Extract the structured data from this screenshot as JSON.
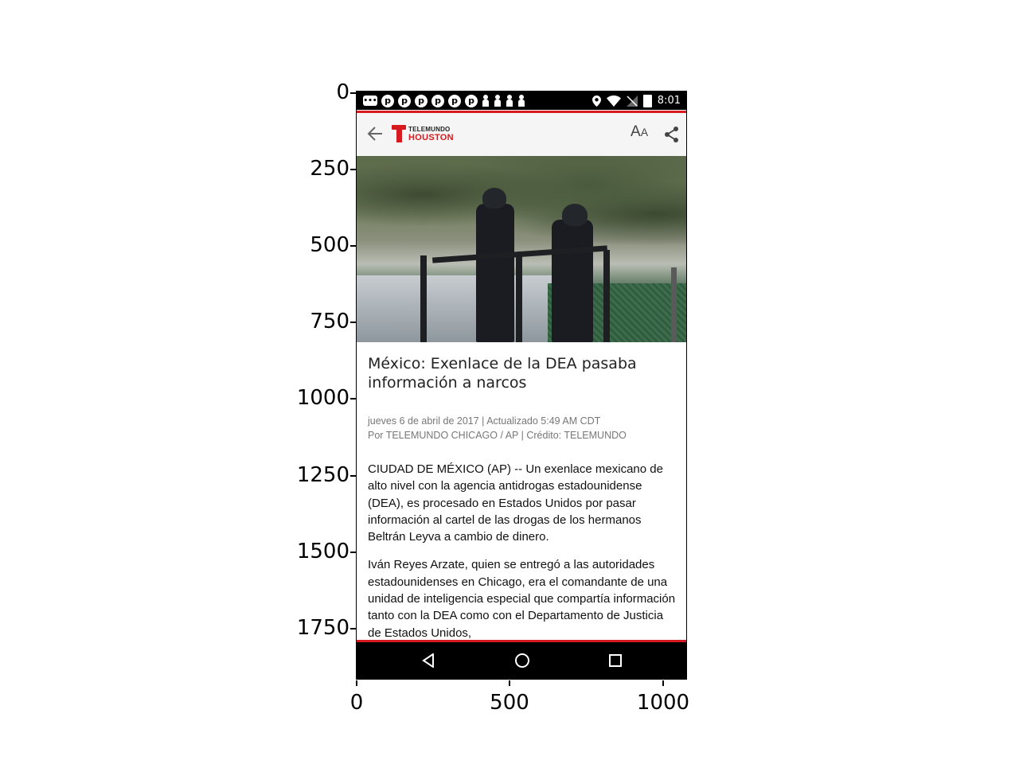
{
  "axes": {
    "y_ticks": [
      "0",
      "250",
      "500",
      "750",
      "1000",
      "1250",
      "1500",
      "1750"
    ],
    "x_ticks": [
      "0",
      "500",
      "1000"
    ]
  },
  "status_bar": {
    "time": "8:01",
    "notification_icons": [
      "message-icon",
      "pinterest-icon",
      "pinterest-icon",
      "pinterest-icon",
      "pinterest-icon",
      "pinterest-icon",
      "pinterest-icon",
      "pawn-icon",
      "pawn-icon",
      "pawn-icon",
      "pawn-icon"
    ],
    "system_icons": [
      "location-icon",
      "wifi-icon",
      "signal-icon",
      "battery-icon"
    ]
  },
  "app_bar": {
    "logo_top": "TELEMUNDO",
    "logo_bottom": "HOUSTON",
    "font_size_label_big": "A",
    "font_size_label_small": "A"
  },
  "article": {
    "headline": "México: Exenlace de la DEA pasaba información a narcos",
    "date_line": "jueves 6 de abril de 2017 | Actualizado 5:49 AM CDT",
    "byline": "Por TELEMUNDO CHICAGO / AP | Crédito: TELEMUNDO",
    "paragraphs": [
      "CIUDAD DE MÉXICO (AP) -- Un exenlace mexicano de alto nivel con la agencia antidrogas estadounidense (DEA), es procesado en Estados Unidos por pasar información al cartel de las drogas de los hermanos Beltrán Leyva a cambio de dinero.",
      "Iván Reyes Arzate, quien se entregó a las autoridades estadounidenses en Chicago, era el comandante de una unidad de inteligencia especial que compartía información tanto con la DEA como con el Departamento de Justicia de Estados Unidos,"
    ]
  },
  "colors": {
    "brand_red": "#d71920",
    "status_bar": "#000000",
    "app_bar": "#f5f5f5"
  }
}
